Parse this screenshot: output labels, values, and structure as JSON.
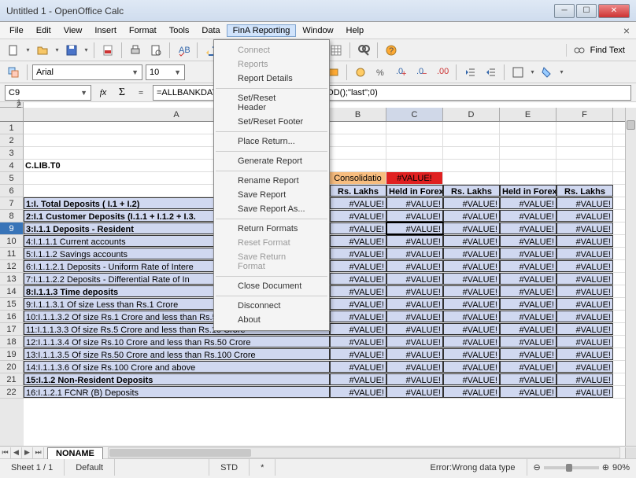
{
  "title": "Untitled 1 - OpenOffice Calc",
  "menubar": [
    "File",
    "Edit",
    "View",
    "Insert",
    "Format",
    "Tools",
    "Data",
    "FinA Reporting",
    "Window",
    "Help"
  ],
  "findtext_label": "Find Text",
  "font_name": "Arial",
  "font_size": "10",
  "name_box": "C9",
  "formula": "=ALLBANKDATA(G$1;$A9;\"form\";CURPERIOD();\"last\";0)",
  "splitrows": [
    "1",
    "2"
  ],
  "colheaders": [
    "A",
    "B",
    "C",
    "D",
    "E",
    "F"
  ],
  "rowheaders": [
    "1",
    "2",
    "3",
    "4",
    "5",
    "6",
    "7",
    "8",
    "9",
    "10",
    "11",
    "12",
    "13",
    "14",
    "15",
    "16",
    "17",
    "18",
    "19",
    "20",
    "21",
    "22"
  ],
  "selected_row_index": 8,
  "c_lib": "C.LIB.T0",
  "consolidation": "Consolidatio",
  "hvalue": "#VALUE!",
  "hdr_rs": "Rs. Lakhs",
  "hdr_forex": "Held in Forex",
  "data_rows": [
    {
      "a": "1:I. Total Deposits ( I.1 + I.2)"
    },
    {
      "a": "2:I.1 Customer Deposits (I.1.1 + I.1.2 + I.3."
    },
    {
      "a": "3:I.1.1 Deposits - Resident"
    },
    {
      "a": "4:I.1.1.1 Current accounts"
    },
    {
      "a": "5:I.1.1.2 Savings accounts"
    },
    {
      "a": "6:I.1.1.2.1 Deposits - Uniform Rate of Intere"
    },
    {
      "a": "7:I.1.1.2.2 Deposits - Differential Rate of In"
    },
    {
      "a": "8:I.1.1.3 Time deposits"
    },
    {
      "a": "9:I.1.1.3.1 Of size Less than Rs.1 Crore"
    },
    {
      "a": "10:I.1.1.3.2 Of size Rs.1 Crore and less than Rs.5 Crore"
    },
    {
      "a": "11:I.1.1.3.3 Of size Rs.5 Crore and less than Rs.10 Crore"
    },
    {
      "a": "12:I.1.1.3.4 Of size Rs.10 Crore and less than Rs.50 Crore"
    },
    {
      "a": "13:I.1.1.3.5 Of size Rs.50 Crore and less than Rs.100 Crore"
    },
    {
      "a": "14:I.1.1.3.6 Of size Rs.100 Crore and above"
    },
    {
      "a": "15:I.1.2 Non-Resident Deposits"
    },
    {
      "a": "16:I.1.2.1 FCNR (B) Deposits"
    }
  ],
  "val": "#VALUE!",
  "tab_name": "NONAME",
  "status": {
    "sheet": "Sheet 1 / 1",
    "style": "Default",
    "std": "STD",
    "star": "*",
    "error": "Error:Wrong data type",
    "zoom_minus": "⊖",
    "zoom_plus": "⊕",
    "zoom_pct": "90%"
  },
  "dropdown": [
    {
      "t": "Connect",
      "d": true
    },
    {
      "t": "Reports",
      "d": true
    },
    {
      "t": "Report Details"
    },
    {
      "sep": true
    },
    {
      "t": "Set/Reset Header"
    },
    {
      "t": "Set/Reset Footer"
    },
    {
      "sep": true
    },
    {
      "t": "Place Return..."
    },
    {
      "sep": true
    },
    {
      "t": "Generate Report"
    },
    {
      "sep": true
    },
    {
      "t": "Rename Report"
    },
    {
      "t": "Save Report"
    },
    {
      "t": "Save Report As..."
    },
    {
      "sep": true
    },
    {
      "t": "Return Formats"
    },
    {
      "t": "Reset Format",
      "d": true
    },
    {
      "t": "Save Return Format",
      "d": true
    },
    {
      "sep": true
    },
    {
      "t": "Close Document"
    },
    {
      "sep": true
    },
    {
      "t": "Disconnect"
    },
    {
      "t": "About"
    }
  ]
}
